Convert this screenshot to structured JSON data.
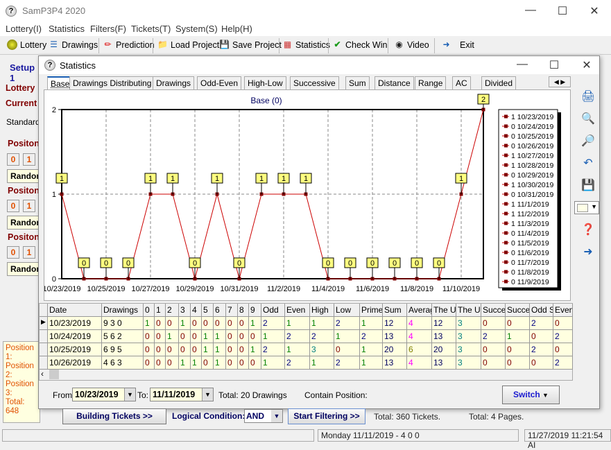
{
  "app": {
    "title": "SamP3P4 2020",
    "icon": "app-logo-icon"
  },
  "menu": [
    "Lottery(I)",
    "Statistics",
    "Filters(F)",
    "Tickets(T)",
    "System(S)",
    "Help(H)"
  ],
  "toolbar": [
    {
      "label": "Lottery",
      "icon": "lottery-ball-icon"
    },
    {
      "label": "Drawings",
      "icon": "list-icon"
    },
    {
      "label": "Prediction",
      "icon": "pencil-icon"
    },
    {
      "label": "Load Project",
      "icon": "folder-open-icon"
    },
    {
      "label": "Save Project",
      "icon": "save-icon"
    },
    {
      "label": "Statistics",
      "icon": "bar-chart-icon"
    },
    {
      "label": "Check Win",
      "icon": "checkmark-icon"
    },
    {
      "label": "Video",
      "icon": "play-icon"
    },
    {
      "label": "Exit",
      "icon": "exit-icon"
    }
  ],
  "left": {
    "setup": "Setup 1",
    "lottery": "Lottery",
    "current": "Current",
    "standard": "Standard",
    "position_label": "Positon",
    "btn0": "0",
    "btn1": "1",
    "random": "Random",
    "positions": [
      "Position 1:",
      "Position 2:",
      "Position 3:",
      "Total: 648"
    ]
  },
  "dialog": {
    "title": "Statistics",
    "tabs": [
      "Base",
      "Drawings Distributing",
      "Drawings",
      "Odd-Even",
      "High-Low",
      "Successive",
      "Sum",
      "Distance",
      "Range",
      "AC",
      "Divided"
    ],
    "active_tab": "Base"
  },
  "chart_data": {
    "type": "line",
    "title": "Base (0)",
    "x": [
      "10/23/2019",
      "10/24/2019",
      "10/25/2019",
      "10/26/2019",
      "10/27/2019",
      "10/28/2019",
      "10/29/2019",
      "10/30/2019",
      "10/31/2019",
      "11/1/2019",
      "11/2/2019",
      "11/3/2019",
      "11/4/2019",
      "11/5/2019",
      "11/6/2019",
      "11/7/2019",
      "11/8/2019",
      "11/9/2019",
      "11/10/2019",
      "11/11/2019"
    ],
    "values": [
      1,
      0,
      0,
      0,
      1,
      1,
      0,
      1,
      0,
      1,
      1,
      1,
      0,
      0,
      0,
      0,
      0,
      0,
      1,
      2
    ],
    "ylim": [
      0,
      2
    ],
    "yticks": [
      "0",
      "1",
      "2"
    ],
    "xticks": [
      "10/23/2019",
      "10/25/2019",
      "10/27/2019",
      "10/29/2019",
      "10/31/2019",
      "11/2/2019",
      "11/4/2019",
      "11/6/2019",
      "11/8/2019",
      "11/10/2019"
    ],
    "grid": true,
    "line_color": "#cc0000",
    "label_bg": "#ffff80",
    "legend_placement": "right",
    "legend": [
      "1 10/23/2019",
      "0 10/24/2019",
      "0 10/25/2019",
      "0 10/26/2019",
      "1 10/27/2019",
      "1 10/28/2019",
      "0 10/29/2019",
      "1 10/30/2019",
      "0 10/31/2019",
      "1 11/1/2019",
      "1 11/2/2019",
      "1 11/3/2019",
      "0 11/4/2019",
      "0 11/5/2019",
      "0 11/6/2019",
      "0 11/7/2019",
      "0 11/8/2019",
      "0 11/9/2019"
    ]
  },
  "table": {
    "columns": [
      "Date",
      "Drawings",
      "0",
      "1",
      "2",
      "3",
      "4",
      "5",
      "6",
      "7",
      "8",
      "9",
      "Odd",
      "Even",
      "High",
      "Low",
      "Prime",
      "Sum",
      "Averag",
      "The U",
      "The U",
      "Succe",
      "Succe",
      "Odd S",
      "Even"
    ],
    "rows": [
      [
        "10/23/2019",
        "9 3 0",
        "1",
        "0",
        "0",
        "1",
        "0",
        "0",
        "0",
        "0",
        "0",
        "1",
        "2",
        "1",
        "1",
        "2",
        "1",
        "12",
        "4",
        "12",
        "3",
        "0",
        "0",
        "2",
        "0"
      ],
      [
        "10/24/2019",
        "5 6 2",
        "0",
        "0",
        "1",
        "0",
        "0",
        "1",
        "1",
        "0",
        "0",
        "0",
        "1",
        "2",
        "2",
        "1",
        "2",
        "13",
        "4",
        "13",
        "3",
        "2",
        "1",
        "0",
        "2"
      ],
      [
        "10/25/2019",
        "6 9 5",
        "0",
        "0",
        "0",
        "0",
        "0",
        "1",
        "1",
        "0",
        "0",
        "1",
        "2",
        "1",
        "3",
        "0",
        "1",
        "20",
        "6",
        "20",
        "3",
        "0",
        "0",
        "2",
        "0"
      ],
      [
        "10/26/2019",
        "4 6 3",
        "0",
        "0",
        "0",
        "1",
        "1",
        "0",
        "1",
        "0",
        "0",
        "0",
        "1",
        "2",
        "1",
        "2",
        "1",
        "13",
        "4",
        "13",
        "3",
        "0",
        "0",
        "0",
        "2"
      ]
    ],
    "value_colors": {
      "0": "#800000",
      "1": "#008000",
      "2": "#000080",
      "3": "#008080",
      "4": "#ff00ff",
      "6": "#808000"
    }
  },
  "side_tools": [
    "printer-icon",
    "zoom-in-icon",
    "zoom-out-icon",
    "undo-icon",
    "save-icon",
    "color-picker",
    "help-icon",
    "exit-icon"
  ],
  "footer": {
    "from_label": "From:",
    "from": "10/23/2019",
    "to_label": "To:",
    "to": "11/11/2019",
    "total": "Total: 20 Drawings",
    "contain": "Contain Position:",
    "switch": "Switch"
  },
  "bottom": {
    "building": "Building  Tickets >>",
    "logical": "Logical Condition:",
    "logic_value": "AND",
    "start": "Start Filtering  >>",
    "tickets": "Total: 360 Tickets.",
    "pages": "Total: 4 Pages."
  },
  "status": {
    "draw": "Monday 11/11/2019 - 4 0 0",
    "time": "11/27/2019 11:21:54 AI"
  }
}
